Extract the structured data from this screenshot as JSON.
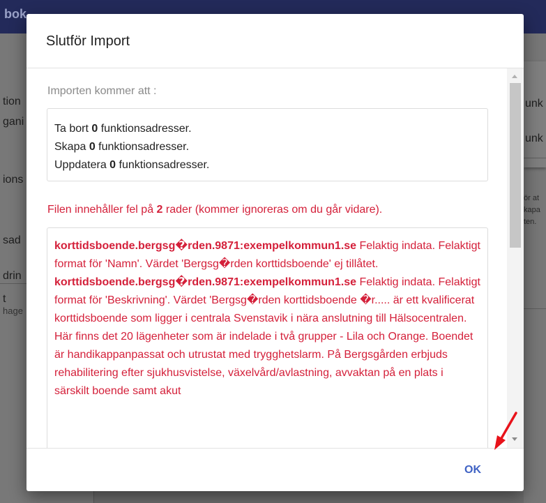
{
  "background": {
    "brand_fragment": "bok",
    "sidebar": [
      {
        "label": "tion"
      },
      {
        "label": "gani"
      },
      {
        "label": "ions"
      },
      {
        "label": "sad"
      },
      {
        "label": "drin"
      },
      {
        "label": "t",
        "sub": "hage"
      }
    ],
    "right_panel": {
      "title_1": "unk",
      "title_2": "unk",
      "text_lines": [
        "ör at",
        "kapa",
        "ten."
      ]
    }
  },
  "dialog": {
    "title": "Slutför Import",
    "intro": "Importen kommer att :",
    "summary": [
      {
        "prefix": "Ta bort ",
        "count": "0",
        "suffix": " funktionsadresser."
      },
      {
        "prefix": "Skapa ",
        "count": "0",
        "suffix": " funktionsadresser."
      },
      {
        "prefix": "Uppdatera ",
        "count": "0",
        "suffix": " funktionsadresser."
      }
    ],
    "error_header": {
      "prefix": "Filen innehåller fel på ",
      "count": "2",
      "suffix": " rader (kommer ignoreras om du går vidare)."
    },
    "errors": [
      {
        "key": "korttidsboende.bergsg�rden.9871:exempelkommun1.se",
        "message": " Felaktig indata. Felaktigt format för 'Namn'. Värdet 'Bergsg�rden korttidsboende' ej tillåtet."
      },
      {
        "key": "korttidsboende.bergsg�rden.9871:exempelkommun1.se",
        "message": " Felaktig indata. Felaktigt format för 'Beskrivning'. Värdet 'Bergsg�rden korttidsboende �r..... är ett kvalificerat korttidsboende som ligger i centrala Svenstavik i nära anslutning till Hälsocentralen. Här finns det 20 lägenheter som är indelade i två grupper - Lila och Orange. Boendet är handikappanpassat och utrustat med trygghetslarm. På Bergsgården erbjuds rehabilitering efter sjukhusvistelse, växelvård/avlastning, avvaktan på en plats i särskilt boende samt akut"
      }
    ],
    "ok_label": "OK"
  },
  "colors": {
    "error": "#d4203a",
    "primary_button": "#3f62c4",
    "annotation_arrow": "#e8121a"
  }
}
